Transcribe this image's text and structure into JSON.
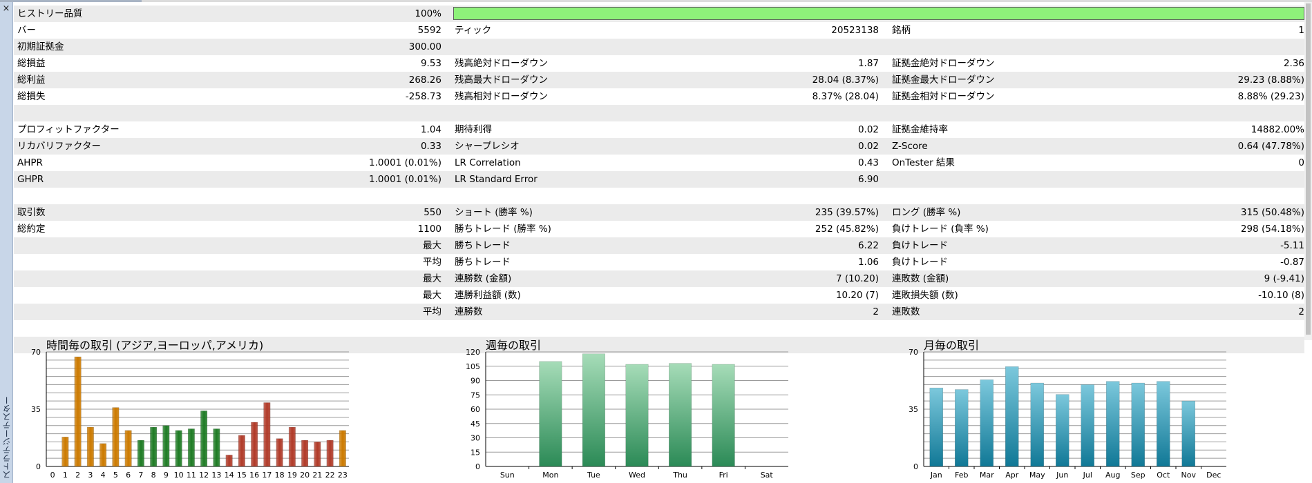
{
  "window": {
    "sidebar_title": "ストラテジーテスター",
    "close_glyph": "×"
  },
  "report": {
    "rows": [
      {
        "shaded": true,
        "type": "quality",
        "l1": "ヒストリー品質",
        "v1": "100%",
        "quality_pct": 100
      },
      {
        "shaded": false,
        "l1": "バー",
        "v1": "5592",
        "l2": "ティック",
        "v2": "20523138",
        "l3": "銘柄",
        "v3": "1"
      },
      {
        "shaded": true,
        "l1": "初期証拠金",
        "v1": "300.00"
      },
      {
        "shaded": false,
        "l1": "総損益",
        "v1": "9.53",
        "l2": "残高絶対ドローダウン",
        "v2": "1.87",
        "l3": "証拠金絶対ドローダウン",
        "v3": "2.36"
      },
      {
        "shaded": true,
        "l1": "総利益",
        "v1": "268.26",
        "l2": "残高最大ドローダウン",
        "v2": "28.04 (8.37%)",
        "l3": "証拠金最大ドローダウン",
        "v3": "29.23 (8.88%)"
      },
      {
        "shaded": false,
        "l1": "総損失",
        "v1": "-258.73",
        "l2": "残高相対ドローダウン",
        "v2": "8.37% (28.04)",
        "l3": "証拠金相対ドローダウン",
        "v3": "8.88% (29.23)"
      },
      {
        "shaded": true
      },
      {
        "shaded": false,
        "l1": "プロフィットファクター",
        "v1": "1.04",
        "l2": "期待利得",
        "v2": "0.02",
        "l3": "証拠金維持率",
        "v3": "14882.00%"
      },
      {
        "shaded": true,
        "l1": "リカバリファクター",
        "v1": "0.33",
        "l2": "シャープレシオ",
        "v2": "0.02",
        "l3": "Z-Score",
        "v3": "0.64 (47.78%)"
      },
      {
        "shaded": false,
        "l1": "AHPR",
        "v1": "1.0001 (0.01%)",
        "l2": "LR Correlation",
        "v2": "0.43",
        "l3": "OnTester 結果",
        "v3": "0"
      },
      {
        "shaded": true,
        "l1": "GHPR",
        "v1": "1.0001 (0.01%)",
        "l2": "LR Standard Error",
        "v2": "6.90"
      },
      {
        "shaded": false
      },
      {
        "shaded": true,
        "l1": "取引数",
        "v1": "550",
        "l2": "ショート (勝率 %)",
        "v2": "235 (39.57%)",
        "l3": "ロング (勝率 %)",
        "v3": "315 (50.48%)"
      },
      {
        "shaded": false,
        "l1": "総約定",
        "v1": "1100",
        "l2": "勝ちトレード (勝率 %)",
        "v2": "252 (45.82%)",
        "l3": "負けトレード (負率 %)",
        "v3": "298 (54.18%)"
      },
      {
        "shaded": true,
        "v1": "最大",
        "l2": "勝ちトレード",
        "v2": "6.22",
        "l3": "負けトレード",
        "v3": "-5.11"
      },
      {
        "shaded": false,
        "v1": "平均",
        "l2": "勝ちトレード",
        "v2": "1.06",
        "l3": "負けトレード",
        "v3": "-0.87"
      },
      {
        "shaded": true,
        "v1": "最大",
        "l2": "連勝数 (金額)",
        "v2": "7 (10.20)",
        "l3": "連敗数 (金額)",
        "v3": "9 (-9.41)"
      },
      {
        "shaded": false,
        "v1": "最大",
        "l2": "連勝利益額 (数)",
        "v2": "10.20 (7)",
        "l3": "連敗損失額 (数)",
        "v3": "-10.10 (8)"
      },
      {
        "shaded": true,
        "v1": "平均",
        "l2": "連勝数",
        "v2": "2",
        "l3": "連敗数",
        "v3": "2"
      },
      {
        "shaded": false
      },
      {
        "shaded": true
      }
    ]
  },
  "chart_data": [
    {
      "type": "bar",
      "title": "時間毎の取引 (アジア,ヨーロッパ,アメリカ)",
      "categories": [
        "0",
        "1",
        "2",
        "3",
        "4",
        "5",
        "6",
        "7",
        "8",
        "9",
        "10",
        "11",
        "12",
        "13",
        "14",
        "15",
        "16",
        "17",
        "18",
        "19",
        "20",
        "21",
        "22",
        "23"
      ],
      "values": [
        0,
        18,
        67,
        24,
        14,
        36,
        22,
        16,
        24,
        25,
        22,
        23,
        34,
        23,
        7,
        19,
        27,
        39,
        17,
        24,
        16,
        15,
        16,
        22
      ],
      "ylim": [
        0,
        70
      ],
      "yticks": [
        "0",
        "35",
        "70"
      ],
      "grid": true,
      "bar_colors": {
        "asia": "#cc7a00",
        "europe": "#1e7b24",
        "america": "#b03a28"
      },
      "session_of_bar": [
        "asia",
        "asia",
        "asia",
        "asia",
        "asia",
        "asia",
        "asia",
        "europe",
        "europe",
        "europe",
        "europe",
        "europe",
        "europe",
        "europe",
        "america",
        "america",
        "america",
        "america",
        "america",
        "america",
        "america",
        "america",
        "america",
        "asia"
      ]
    },
    {
      "type": "bar",
      "title": "週毎の取引",
      "categories": [
        "Sun",
        "Mon",
        "Tue",
        "Wed",
        "Thu",
        "Fri",
        "Sat"
      ],
      "values": [
        0,
        110,
        118,
        107,
        108,
        107,
        0
      ],
      "ylim": [
        0,
        120
      ],
      "yticks": [
        "0",
        "15",
        "30",
        "45",
        "60",
        "75",
        "90",
        "105",
        "120"
      ],
      "grid": true,
      "bar_colors": {
        "top": "#a6dcb8",
        "bottom": "#2b8a56"
      }
    },
    {
      "type": "bar",
      "title": "月毎の取引",
      "categories": [
        "Jan",
        "Feb",
        "Mar",
        "Apr",
        "May",
        "Jun",
        "Jul",
        "Aug",
        "Sep",
        "Oct",
        "Nov",
        "Dec"
      ],
      "values": [
        48,
        47,
        53,
        61,
        51,
        44,
        50,
        52,
        51,
        52,
        40,
        0
      ],
      "ylim": [
        0,
        70
      ],
      "yticks": [
        "0",
        "35",
        "70"
      ],
      "grid": true,
      "bar_colors": {
        "top": "#7cc8dc",
        "bottom": "#107896"
      }
    }
  ]
}
